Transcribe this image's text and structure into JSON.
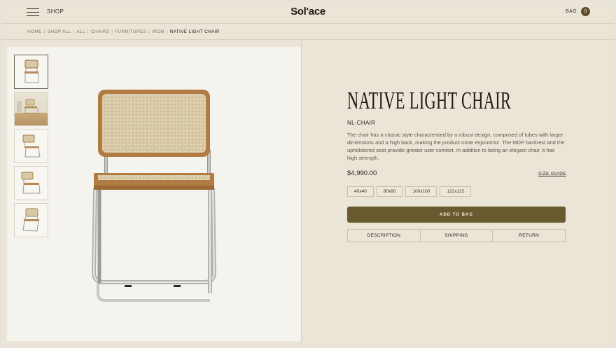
{
  "header": {
    "menu_icon": "hamburger-menu-icon",
    "shop_label": "SHOP",
    "logo": "Sol'ace",
    "bag_label": "BAG",
    "bag_count": "0"
  },
  "breadcrumb": [
    "HOME",
    "SHOP ALL",
    "ALL",
    "CHAIRS",
    "FURNITURES",
    "IRON",
    "NATIVE LIGHT CHAIR"
  ],
  "breadcrumb_separator": "|",
  "gallery": {
    "thumbnails": [
      "front-view",
      "room-scene",
      "side-view",
      "side-view-angled",
      "three-quarter-view"
    ],
    "active_index": 0
  },
  "product": {
    "title": "NATIVE LIGHT CHAIR",
    "sku": "NL-CHAIR",
    "description": "The chair has a classic style characterized by a robust design, composed of tubes with larger dimensions and a high back, making the product more ergonomic. The MDP backrest and the upholstered seat provide greater user comfort. In addition to being an elegant chair, it has high strength.",
    "price": "$4,990.00",
    "size_guide": "SIZE GUIDE",
    "sizes": [
      "40x40",
      "80x80",
      "100x100",
      "122x122"
    ],
    "add_to_bag": "ADD TO BAG",
    "tabs": [
      "DESCRIPTION",
      "SHIPPING",
      "RETURN"
    ]
  },
  "colors": {
    "background": "#ebe5d8",
    "accent": "#6a5a30",
    "gallery_bg": "#f5f3ed"
  }
}
